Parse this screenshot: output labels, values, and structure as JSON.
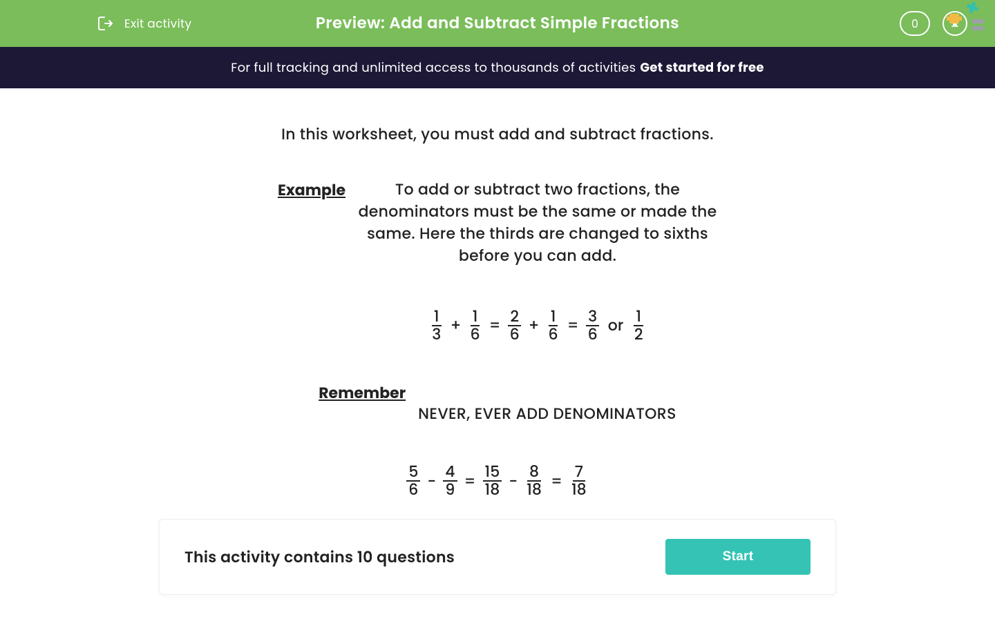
{
  "header": {
    "exit_label": "Exit activity",
    "title": "Preview: Add and Subtract Simple Fractions",
    "score": "0"
  },
  "banner": {
    "text": "For full tracking and unlimited access to thousands of activities ",
    "cta": "Get started for free"
  },
  "content": {
    "intro": "In this worksheet, you must add and subtract fractions.",
    "example_label": "Example",
    "example_body": "To add or subtract two fractions, the denominators must be the same or made the same.  Here the thirds are changed to sixths before you can add.",
    "remember_label": "Remember",
    "remember_body": "NEVER, EVER ADD DENOMINATORS"
  },
  "eq1": {
    "f1n": "1",
    "f1d": "3",
    "op1": "+",
    "f2n": "1",
    "f2d": "6",
    "eq1": "=",
    "f3n": "2",
    "f3d": "6",
    "op2": "+",
    "f4n": "1",
    "f4d": "6",
    "eq2": "=",
    "f5n": "3",
    "f5d": "6",
    "or": "or",
    "f6n": "1",
    "f6d": "2"
  },
  "eq2": {
    "f1n": "5",
    "f1d": "6",
    "op1": "-",
    "f2n": "4",
    "f2d": "9",
    "eq1": "=",
    "f3n": "15",
    "f3d": "18",
    "op2": "-",
    "f4n": "8",
    "f4d": "18",
    "eq2": "=",
    "f5n": "7",
    "f5d": "18"
  },
  "footer": {
    "text": "This activity contains 10 questions",
    "start": "Start"
  },
  "colors": {
    "header_bg": "#7abd5a",
    "banner_bg": "#1d1836",
    "start_bg": "#34c3b4"
  }
}
